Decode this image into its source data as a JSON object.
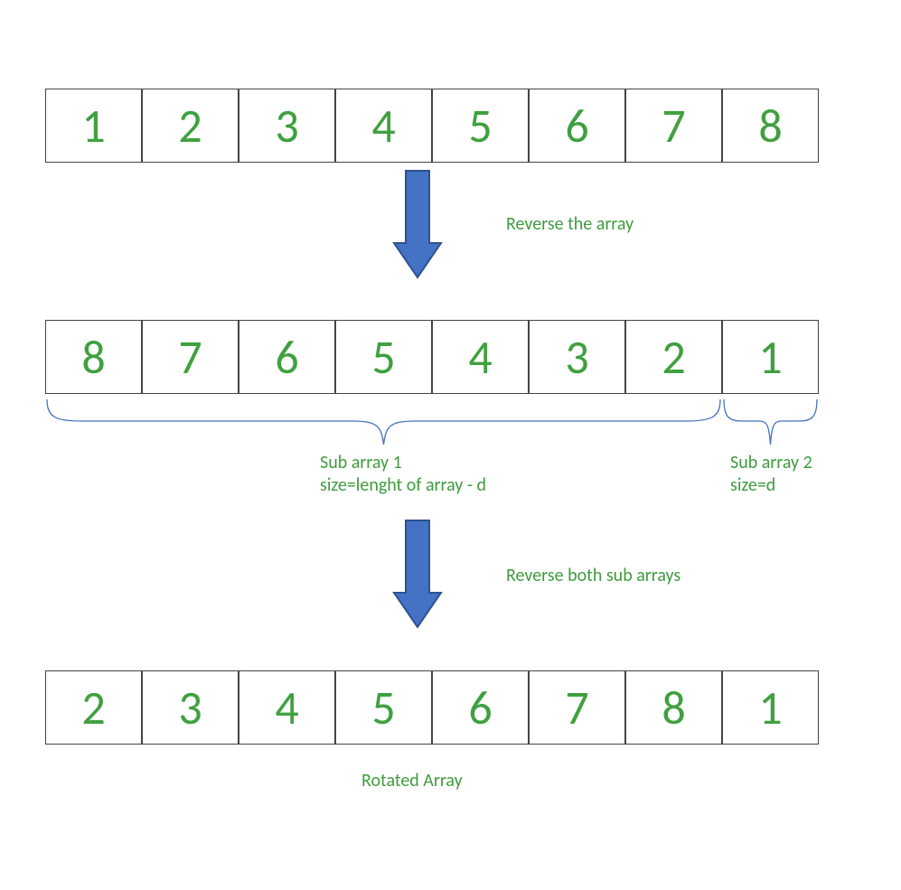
{
  "arrays": {
    "a": [
      "1",
      "2",
      "3",
      "4",
      "5",
      "6",
      "7",
      "8"
    ],
    "b": [
      "8",
      "7",
      "6",
      "5",
      "4",
      "3",
      "2",
      "1"
    ],
    "c": [
      "2",
      "3",
      "4",
      "5",
      "6",
      "7",
      "8",
      "1"
    ]
  },
  "labels": {
    "reverse": "Reverse the array",
    "sub1_line1": "Sub array 1",
    "sub1_line2": "size=lenght of array - d",
    "sub2_line1": "Sub array 2",
    "sub2_line2": "size=d",
    "reverse_both": "Reverse both sub arrays",
    "rotated": "Rotated Array"
  },
  "colors": {
    "text_green": "#3f9b3f",
    "arrow_fill": "#4472c4",
    "arrow_edge": "#2f528f",
    "brace": "#4472c4"
  }
}
